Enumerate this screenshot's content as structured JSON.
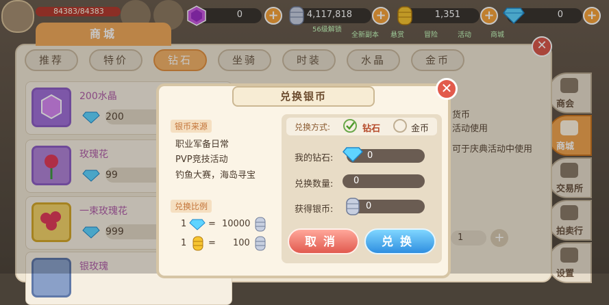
{
  "player": {
    "hp_text": "84383/84383",
    "level_badge": "56"
  },
  "currency": [
    {
      "icon": "purple-crystal-icon",
      "value": "0"
    },
    {
      "icon": "silver-coin-icon",
      "value": "4,117,818"
    },
    {
      "icon": "gold-coin-icon",
      "value": "1,351"
    },
    {
      "icon": "diamond-icon",
      "value": "0"
    }
  ],
  "bg_labels": {
    "top_feature": "56级解锁",
    "tabs": [
      "全新副本",
      "悬赏",
      "冒险",
      "活动",
      "商城"
    ],
    "desc1": "货币",
    "desc2": "活动使用",
    "desc3": "可于庆典活动中使用",
    "qty": "1"
  },
  "shop": {
    "title": "商城",
    "tabs": [
      "推荐",
      "特价",
      "钻石",
      "坐骑",
      "时装",
      "水晶",
      "金币"
    ],
    "active_tab": "钻石",
    "items": [
      {
        "name": "200水晶",
        "price": "200",
        "icon": "purple-crystal-icon"
      },
      {
        "name": "玫瑰花",
        "price": "99",
        "icon": "rose-icon"
      },
      {
        "name": "一束玫瑰花",
        "price": "999",
        "icon": "rose-bouquet-icon"
      },
      {
        "name": "银玫瑰",
        "price": "",
        "icon": "silver-rose-icon"
      }
    ]
  },
  "side_nav": [
    {
      "label": "商会",
      "icon": "guild-icon"
    },
    {
      "label": "商城",
      "icon": "shop-icon",
      "active": true
    },
    {
      "label": "交易所",
      "icon": "scales-icon"
    },
    {
      "label": "拍卖行",
      "icon": "hammer-icon"
    },
    {
      "label": "设置",
      "icon": "gear-icon"
    }
  ],
  "dialog": {
    "title": "兑换银币",
    "source_header": "银币来源",
    "sources": [
      "职业军备日常",
      "PVP竞技活动",
      "钓鱼大赛，海岛寻宝"
    ],
    "ratio_header": "兑换比例",
    "ratios": [
      {
        "left": "1",
        "op": "=",
        "right": "10000",
        "from_icon": "diamond-icon",
        "to_icon": "silver-coin-icon"
      },
      {
        "left": "1",
        "op": "=",
        "right": "100",
        "from_icon": "gold-coin-icon",
        "to_icon": "silver-coin-icon"
      }
    ],
    "method_label": "兑换方式:",
    "method_options": [
      {
        "label": "钻石",
        "selected": true
      },
      {
        "label": "金币",
        "selected": false
      }
    ],
    "my_diamond_label": "我的钻石:",
    "my_diamond_value": "0",
    "qty_label": "兑换数量:",
    "qty_value": "0",
    "get_label": "获得银币:",
    "get_value": "0",
    "cancel_label": "取消",
    "confirm_label": "兑换"
  }
}
